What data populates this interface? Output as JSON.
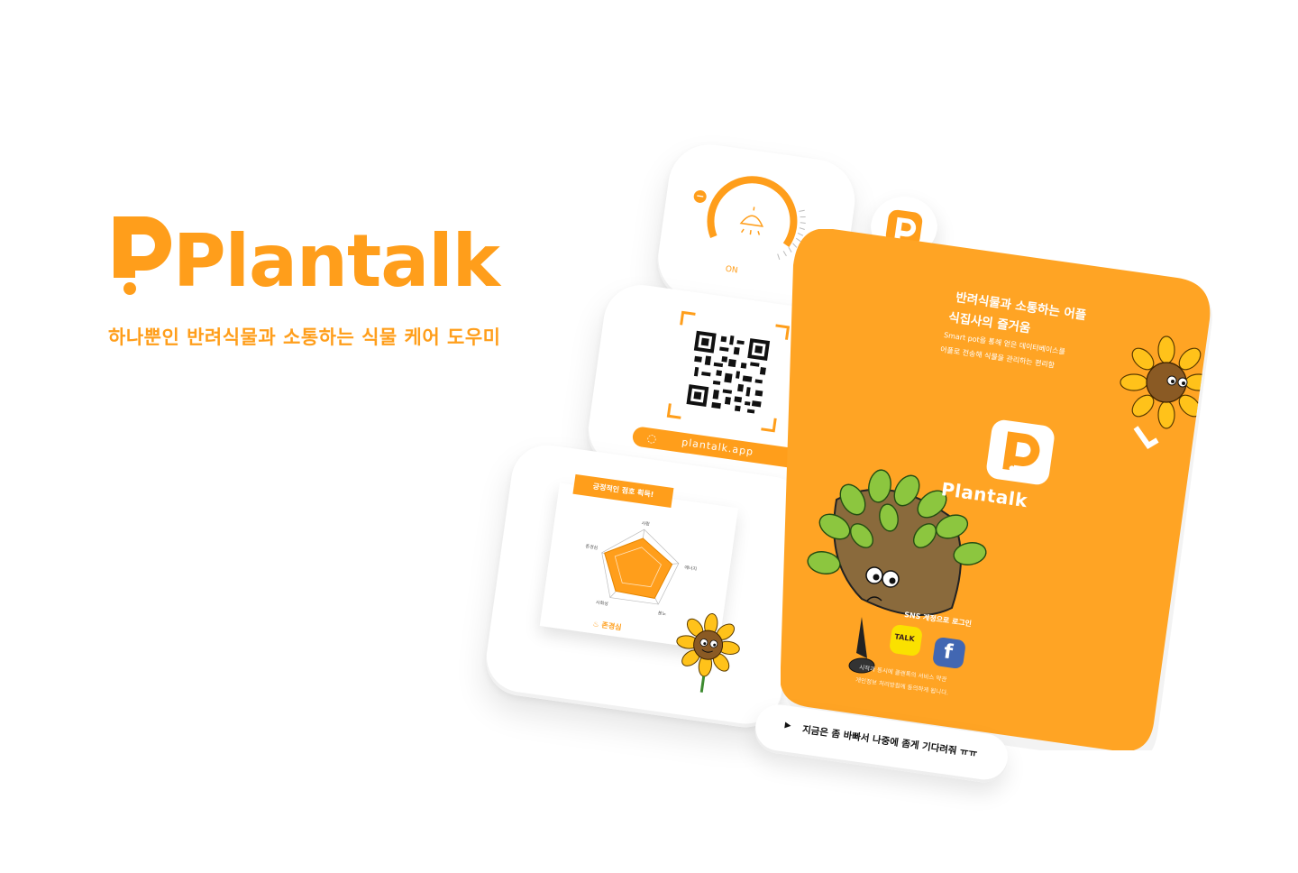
{
  "brand": {
    "name": "Plantalk",
    "tagline": "하나뿐인 반려식물과 소통하는 식물 케어 도우미",
    "accent_color": "#FF9E1B"
  },
  "dial_card": {
    "minus_label": "−",
    "plus_label": "+",
    "status_label": "ON",
    "icon": "lamp-icon"
  },
  "qr_card": {
    "url": "plantalk.app",
    "icon": "qr-code-icon"
  },
  "radar_card": {
    "banner": "긍정적인 점호 획득!",
    "axes": [
      "사랑",
      "에너지",
      "분노",
      "사회성",
      "존경심"
    ],
    "highlight": "존경심"
  },
  "phone": {
    "headline_1": "반려식물과 소통하는 어플",
    "headline_2": "식집사의 즐거움",
    "subtext_1": "Smart pot을 통해 얻은 데이터베이스를",
    "subtext_2": "어플로 전송해 식물을 관리하는 편리함",
    "app_name": "Plantalk",
    "sns_label": "SNS 계정으로 로그인",
    "kakao_label": "TALK",
    "facebook_label": "f",
    "terms_1": "시작과 동시에 플랜톡의 서비스 약관",
    "terms_2": "개인정보 처리방침에 동의하게 됩니다."
  },
  "speech_pill": {
    "text": "지금은 좀 바빠서 나중에 좀게 기다려줘 ㅠㅠ"
  }
}
